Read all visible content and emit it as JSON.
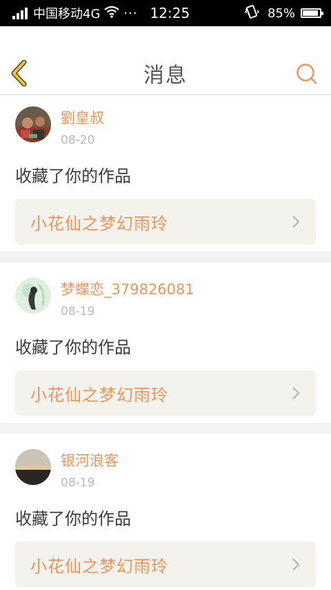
{
  "status_bar": {
    "carrier": "中国移动4G",
    "dots": "···",
    "time": "12:25",
    "battery": "85%"
  },
  "header": {
    "title": "消息"
  },
  "messages": [
    {
      "username": "劉皇叔",
      "date": "08-20",
      "action": "收藏了你的作品",
      "work_title": "小花仙之梦幻雨玲"
    },
    {
      "username": "梦蝶恋_379826081",
      "date": "08-19",
      "action": "收藏了你的作品",
      "work_title": "小花仙之梦幻雨玲"
    },
    {
      "username": "银河浪客",
      "date": "08-19",
      "action": "收藏了你的作品",
      "work_title": "小花仙之梦幻雨玲"
    }
  ],
  "colors": {
    "accent": "#f0935a",
    "back_icon": "#f3c623",
    "card_bg": "#f3f2ec"
  }
}
